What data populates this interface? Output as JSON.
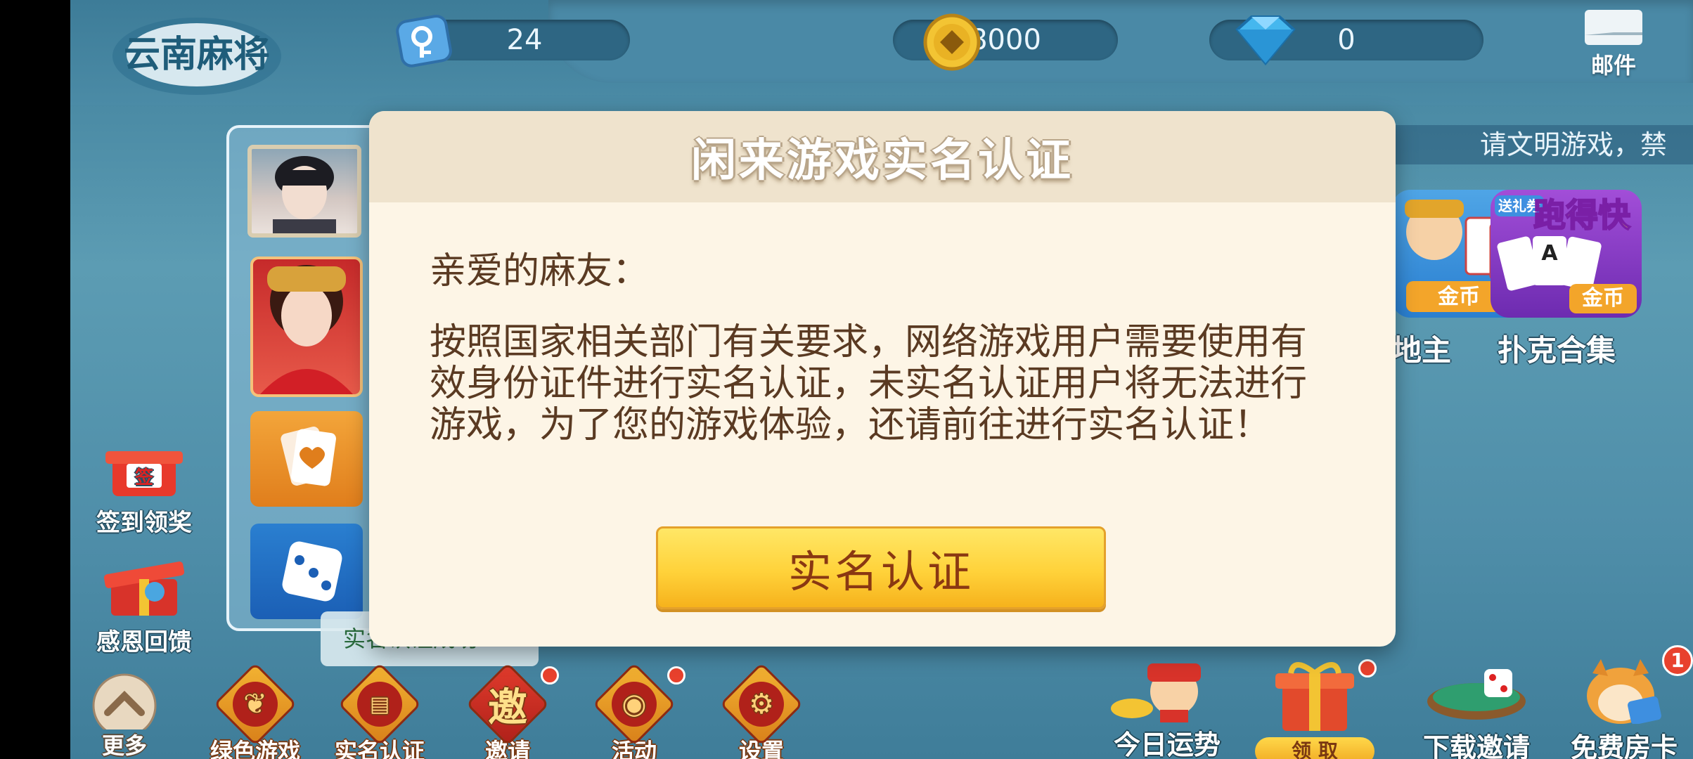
{
  "header": {
    "logo_text": "云南麻将",
    "keys": "24",
    "coins": "8000",
    "diamonds": "0",
    "mail_label": "邮件"
  },
  "notice": "请文明游戏，禁",
  "side_buttons": {
    "signin": "签到领奖",
    "feedback": "感恩回馈"
  },
  "toast_text": "实名认证成功",
  "games": [
    {
      "label": "地主",
      "badge": "金币"
    },
    {
      "label": "扑克合集",
      "badge": "金币",
      "tag": "送礼券",
      "title": "跑得快"
    }
  ],
  "bottom": {
    "more": "更多",
    "green": "绿色游戏",
    "realname": "实名认证",
    "invite": "邀请",
    "invite_char": "邀",
    "activity": "活动",
    "settings": "设置",
    "fortune": "今日运势",
    "claim": "领 取",
    "download": "下载邀请",
    "free_card": "免费房卡",
    "free_card_count": "1"
  },
  "modal": {
    "title": "闲来游戏实名认证",
    "greeting": "亲爱的麻友：",
    "body": "按照国家相关部门有关要求，网络游戏用户需要使用有效身份证件进行实名认证，未实名认证用户将无法进行游戏，为了您的游戏体验，还请前往进行实名认证！",
    "button": "实名认证"
  }
}
